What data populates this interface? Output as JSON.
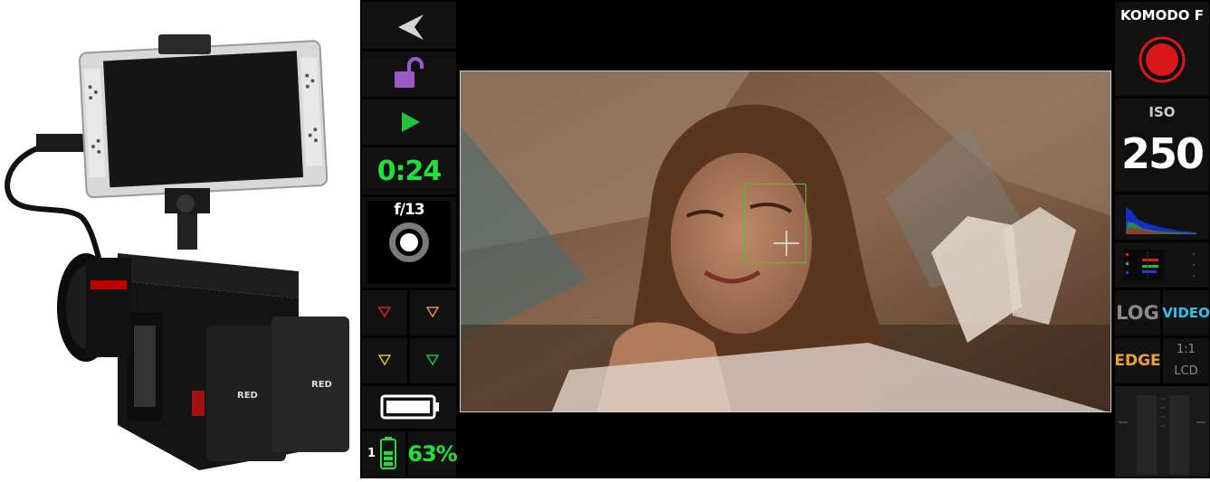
{
  "left_panel": {
    "timecode": "0:24",
    "aperture": "f/13",
    "battery_slot": "1",
    "battery_percent": "63%"
  },
  "right_panel": {
    "camera_model": "KOMODO F",
    "iso_label": "ISO",
    "iso_value": "250",
    "log_label": "LOG",
    "video_label": "VIDEO",
    "edge_label": "EDGE",
    "lcd_ratio": "1:1",
    "lcd_label": "LCD"
  },
  "colors": {
    "timecode_green": "#22e03a",
    "lock_purple": "#9b59c9",
    "record_red": "#d81818",
    "video_blue": "#2ec3ee",
    "edge_orange": "#f0a030",
    "focus_box": "#4fbf3a"
  },
  "icons": [
    "back-arrow-icon",
    "unlock-icon",
    "play-icon",
    "aperture-dial-icon",
    "triangle-down-red-icon",
    "triangle-down-orange-icon",
    "triangle-down-yellow-icon",
    "triangle-down-green-icon",
    "battery-icon",
    "battery-small-icon",
    "record-icon",
    "histogram-icon",
    "rgb-meter-icon",
    "audio-meter-icon",
    "crosshair-icon"
  ]
}
